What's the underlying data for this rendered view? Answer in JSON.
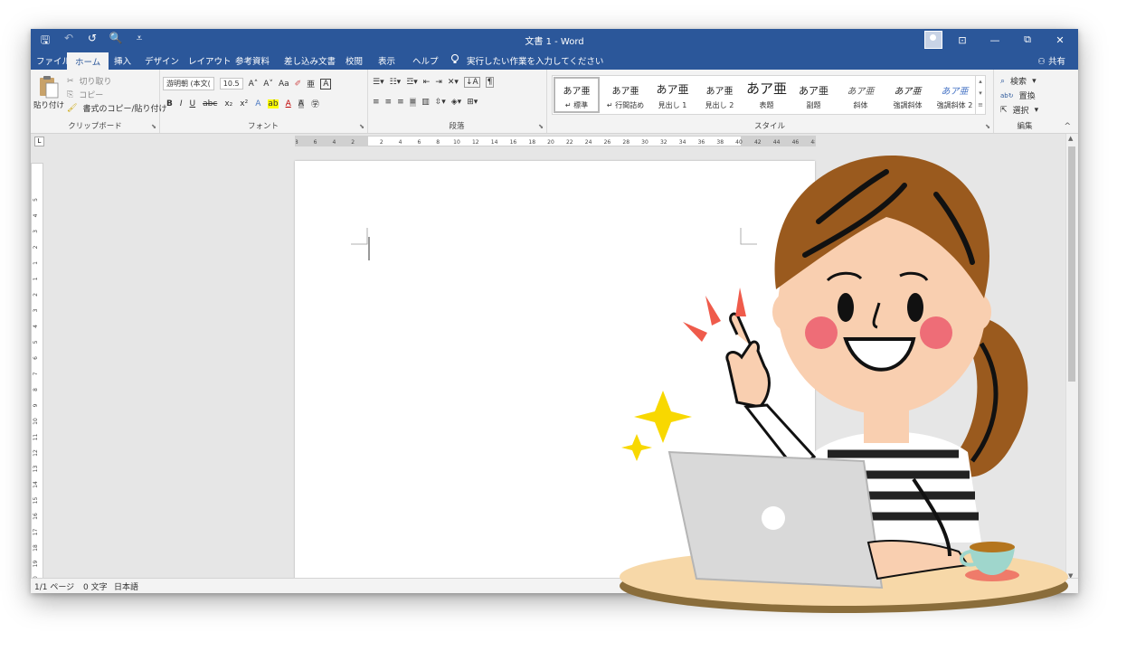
{
  "titlebar": {
    "title": "文書 1  -  Word",
    "qat": {
      "save": "🖫",
      "undo": "↶",
      "redo": "↺",
      "preview": "🔍",
      "more": "⩡"
    },
    "controls": {
      "ribbon_opts": "⊡",
      "minimize": "—",
      "restore": "⧉",
      "close": "✕"
    }
  },
  "tabs": [
    "ファイル",
    "ホーム",
    "挿入",
    "デザイン",
    "レイアウト",
    "参考資料",
    "差し込み文書",
    "校閲",
    "表示",
    "ヘルプ"
  ],
  "active_tab": "ホーム",
  "tell_me": "実行したい作業を入力してください",
  "share": "共有",
  "clipboard": {
    "label": "クリップボード",
    "paste": "貼り付け",
    "cut": "切り取り",
    "copy": "コピー",
    "format_painter": "書式のコピー/貼り付け"
  },
  "font": {
    "label": "フォント",
    "font_name": "游明朝 (本文(",
    "font_size": "10.5",
    "grow": "A˄",
    "shrink": "A˅",
    "case": "Aa",
    "bold": "B",
    "italic": "I",
    "underline": "U",
    "strike": "abc",
    "subscript": "x₂",
    "superscript": "x²"
  },
  "paragraph": {
    "label": "段落"
  },
  "styles": {
    "label": "スタイル",
    "items": [
      {
        "sample": "あア亜",
        "name": "↵ 標準"
      },
      {
        "sample": "あア亜",
        "name": "↵ 行間詰め"
      },
      {
        "sample": "あア亜",
        "name": "見出し 1"
      },
      {
        "sample": "あア亜",
        "name": "見出し 2"
      },
      {
        "sample": "あア亜",
        "name": "表題"
      },
      {
        "sample": "あア亜",
        "name": "副題"
      },
      {
        "sample": "あア亜",
        "name": "斜体"
      },
      {
        "sample": "あア亜",
        "name": "強調斜体"
      },
      {
        "sample": "あア亜",
        "name": "強調斜体 2"
      }
    ]
  },
  "editing": {
    "label": "編集",
    "find": "検索",
    "replace": "置換",
    "select": "選択"
  },
  "ruler": {
    "h_left_ticks": [
      "8",
      "6",
      "4",
      "2"
    ],
    "h_right_ticks": [
      "2",
      "4",
      "6",
      "8",
      "10",
      "12",
      "14",
      "16",
      "18",
      "20",
      "22",
      "24",
      "26",
      "28",
      "30",
      "32",
      "34",
      "36",
      "38",
      "40",
      "42",
      "44",
      "46",
      "48"
    ],
    "v_ticks": [
      "5",
      "4",
      "3",
      "2",
      "1",
      "1",
      "2",
      "3",
      "4",
      "5",
      "6",
      "7",
      "8",
      "9",
      "10",
      "11",
      "12",
      "13",
      "14",
      "15",
      "16",
      "17",
      "18",
      "19",
      "20",
      "21"
    ]
  },
  "status": {
    "page": "1/1 ページ",
    "words": "0 文字",
    "language": "日本語"
  },
  "colors": {
    "accent": "#2b579a",
    "ribbon_bg": "#f3f3f3",
    "canvas_bg": "#e6e6e6",
    "hair": "#9a5a1e",
    "skin": "#f9cfb0",
    "table_top": "#f7d8a8",
    "laptop": "#d9d9d9",
    "sparkle": "#f8d800"
  },
  "icons": [
    "save-icon",
    "undo-icon",
    "redo-icon",
    "print-preview-icon",
    "lightbulb-icon",
    "share-icon",
    "search-icon",
    "replace-icon",
    "select-icon",
    "paste-icon",
    "cut-icon",
    "copy-icon",
    "format-painter-icon"
  ]
}
